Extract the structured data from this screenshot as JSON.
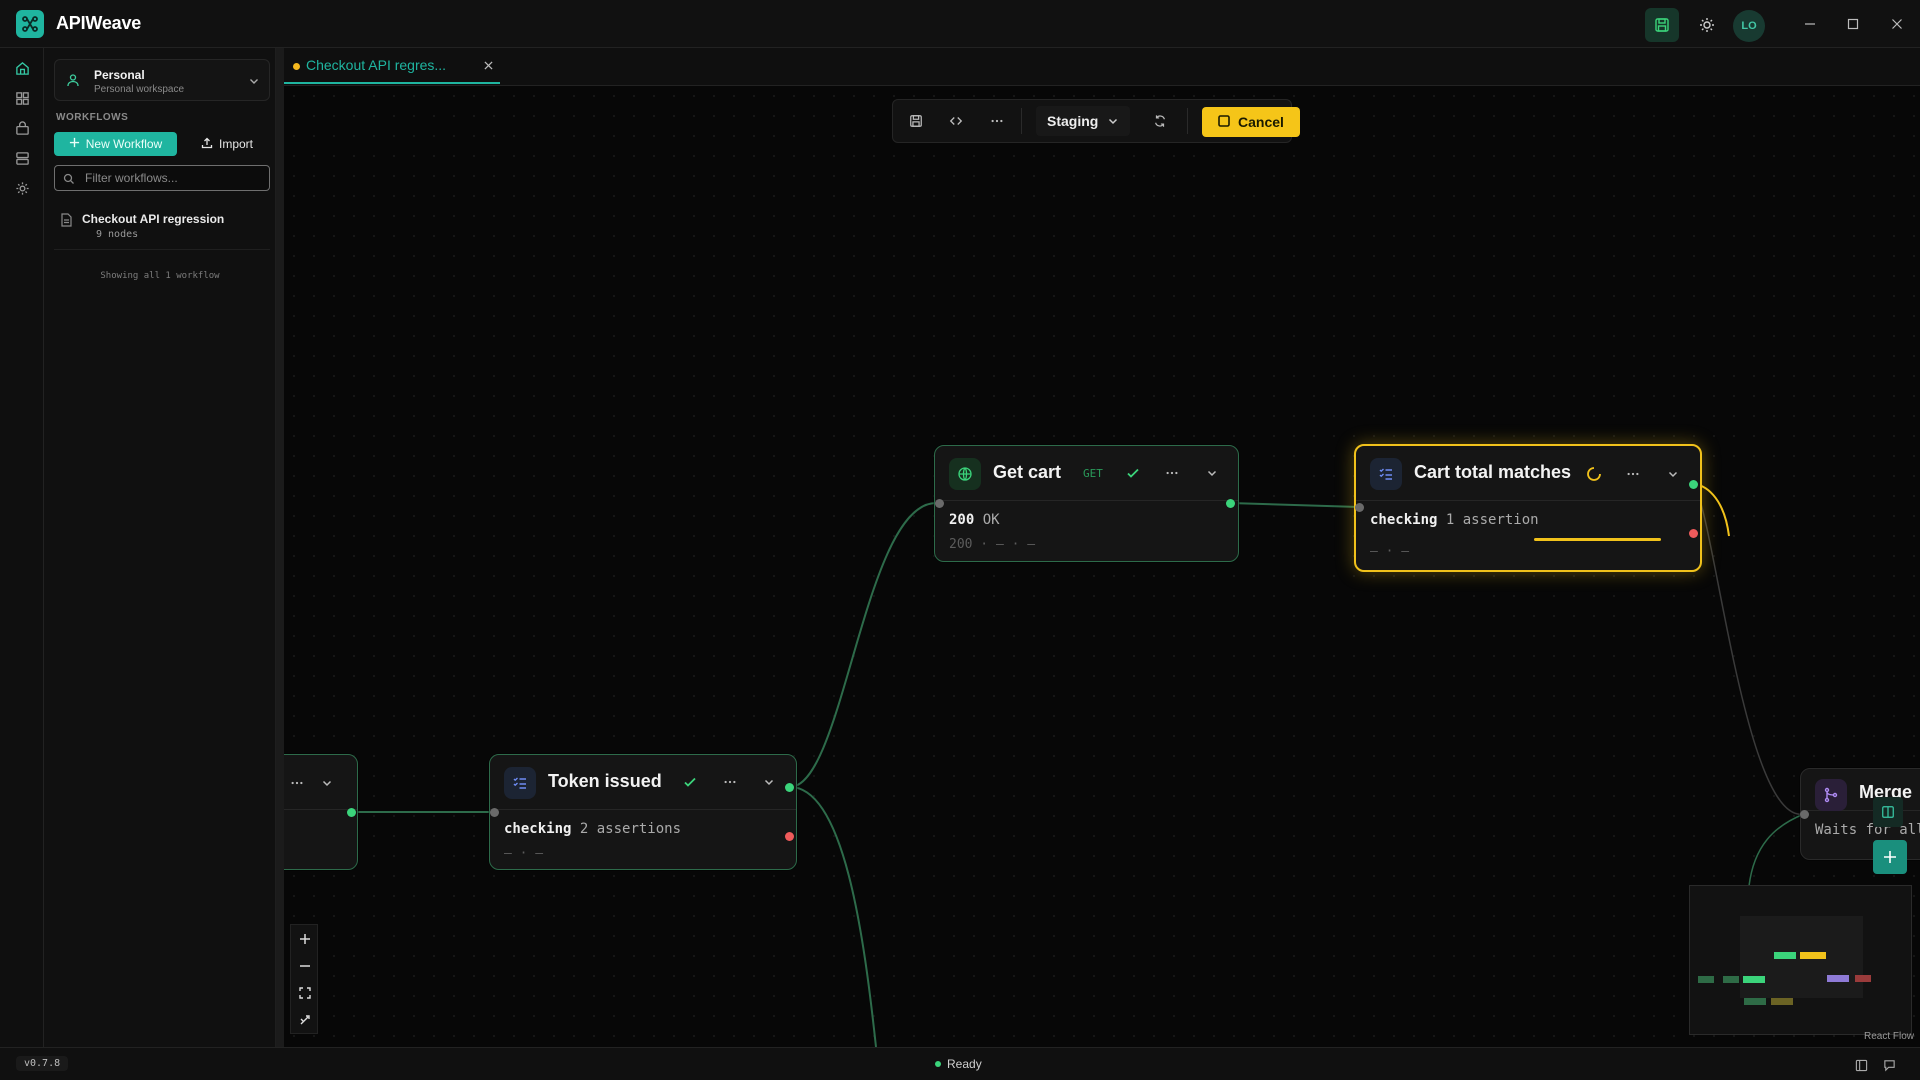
{
  "app": {
    "name": "APIWeave"
  },
  "titlebar": {
    "avatar_initials": "LO"
  },
  "sidebar": {
    "workspace_name": "Personal",
    "workspace_sub": "Personal workspace",
    "section_label": "WORKFLOWS",
    "new_workflow_label": "New Workflow",
    "import_label": "Import",
    "filter_placeholder": "Filter workflows...",
    "workflows": [
      {
        "name": "Checkout API regression",
        "meta": "9 nodes"
      }
    ],
    "count_text": "Showing all 1 workflow"
  },
  "tabs": [
    {
      "label": "Checkout API regres..."
    }
  ],
  "toolbar": {
    "environment": "Staging",
    "cancel_label": "Cancel"
  },
  "nodes": {
    "token": {
      "title": "Token issued",
      "body_keyword": "checking",
      "body_rest": "2 assertions",
      "body2": "— · —"
    },
    "getcart": {
      "title": "Get cart",
      "method": "GET",
      "status_code": "200",
      "status_text": "OK",
      "body2": "200 · — · —"
    },
    "carttotal": {
      "title": "Cart total matches",
      "body_keyword": "checking",
      "body_rest": "1 assertion",
      "body2": "— · —"
    },
    "merge": {
      "title": "Merge",
      "body": "Waits for all"
    }
  },
  "colors": {
    "accent": "#1fb5a0",
    "success": "#3bd47b",
    "error": "#ef5b5b",
    "running": "#f1c21b"
  },
  "canvas": {
    "credit": "React Flow"
  },
  "statusbar": {
    "version": "v0.7.8",
    "status": "Ready"
  }
}
